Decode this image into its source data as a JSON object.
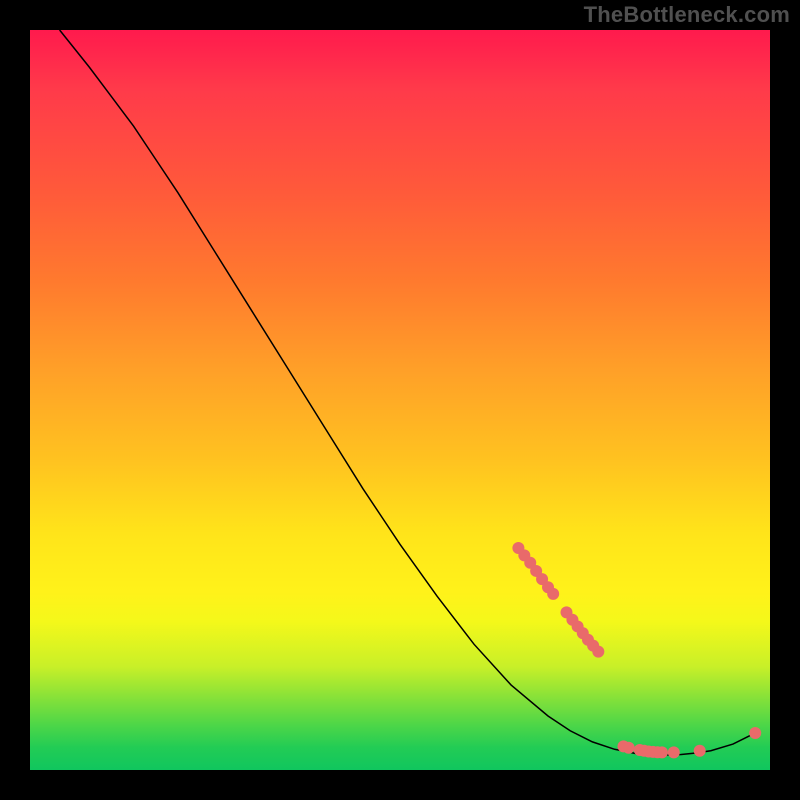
{
  "watermark": "TheBottleneck.com",
  "chart_data": {
    "type": "line",
    "title": "",
    "xlabel": "",
    "ylabel": "",
    "xlim": [
      0,
      100
    ],
    "ylim": [
      0,
      100
    ],
    "grid": false,
    "curve": [
      {
        "x": 4,
        "y": 100
      },
      {
        "x": 6,
        "y": 97.5
      },
      {
        "x": 8,
        "y": 95
      },
      {
        "x": 11,
        "y": 91
      },
      {
        "x": 14,
        "y": 87
      },
      {
        "x": 17,
        "y": 82.5
      },
      {
        "x": 20,
        "y": 78
      },
      {
        "x": 25,
        "y": 70
      },
      {
        "x": 30,
        "y": 62
      },
      {
        "x": 35,
        "y": 54
      },
      {
        "x": 40,
        "y": 46
      },
      {
        "x": 45,
        "y": 38
      },
      {
        "x": 50,
        "y": 30.5
      },
      {
        "x": 55,
        "y": 23.5
      },
      {
        "x": 60,
        "y": 17
      },
      {
        "x": 65,
        "y": 11.5
      },
      {
        "x": 70,
        "y": 7.3
      },
      {
        "x": 73,
        "y": 5.3
      },
      {
        "x": 76,
        "y": 3.8
      },
      {
        "x": 79,
        "y": 2.8
      },
      {
        "x": 82,
        "y": 2.2
      },
      {
        "x": 85,
        "y": 2.0
      },
      {
        "x": 88,
        "y": 2.1
      },
      {
        "x": 90,
        "y": 2.3
      },
      {
        "x": 92,
        "y": 2.6
      },
      {
        "x": 95,
        "y": 3.5
      },
      {
        "x": 97,
        "y": 4.5
      },
      {
        "x": 98,
        "y": 5.0
      }
    ],
    "markers": [
      {
        "x": 66.0,
        "y": 30.0
      },
      {
        "x": 66.8,
        "y": 29.0
      },
      {
        "x": 67.6,
        "y": 28.0
      },
      {
        "x": 68.4,
        "y": 26.9
      },
      {
        "x": 69.2,
        "y": 25.8
      },
      {
        "x": 70.0,
        "y": 24.7
      },
      {
        "x": 70.7,
        "y": 23.8
      },
      {
        "x": 72.5,
        "y": 21.3
      },
      {
        "x": 73.3,
        "y": 20.3
      },
      {
        "x": 74.0,
        "y": 19.4
      },
      {
        "x": 74.7,
        "y": 18.5
      },
      {
        "x": 75.4,
        "y": 17.6
      },
      {
        "x": 76.1,
        "y": 16.8
      },
      {
        "x": 76.8,
        "y": 16.0
      },
      {
        "x": 80.2,
        "y": 3.2
      },
      {
        "x": 80.9,
        "y": 3.0
      },
      {
        "x": 82.4,
        "y": 2.7
      },
      {
        "x": 83.0,
        "y": 2.6
      },
      {
        "x": 83.6,
        "y": 2.5
      },
      {
        "x": 84.2,
        "y": 2.45
      },
      {
        "x": 84.8,
        "y": 2.4
      },
      {
        "x": 85.4,
        "y": 2.38
      },
      {
        "x": 87.0,
        "y": 2.38
      },
      {
        "x": 90.5,
        "y": 2.6
      },
      {
        "x": 98.0,
        "y": 5.0
      }
    ]
  }
}
